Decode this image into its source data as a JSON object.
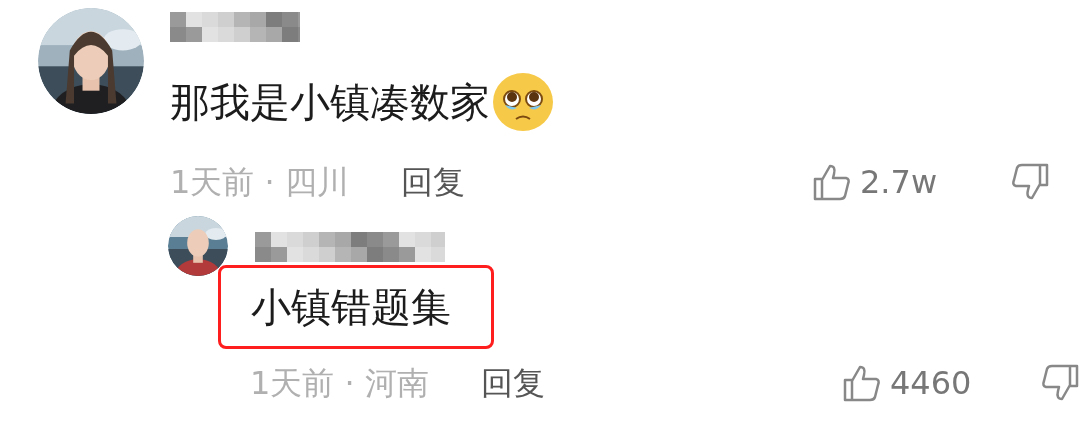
{
  "comments": [
    {
      "text": "那我是小镇凑数家",
      "emoji": true,
      "meta": "1天前 · 四川",
      "reply_label": "回复",
      "likes": "2.7w",
      "highlighted": false,
      "replies": [
        {
          "text": "小镇错题集",
          "emoji": false,
          "meta": "1天前 · 河南",
          "reply_label": "回复",
          "likes": "4460",
          "highlighted": true
        }
      ]
    }
  ]
}
